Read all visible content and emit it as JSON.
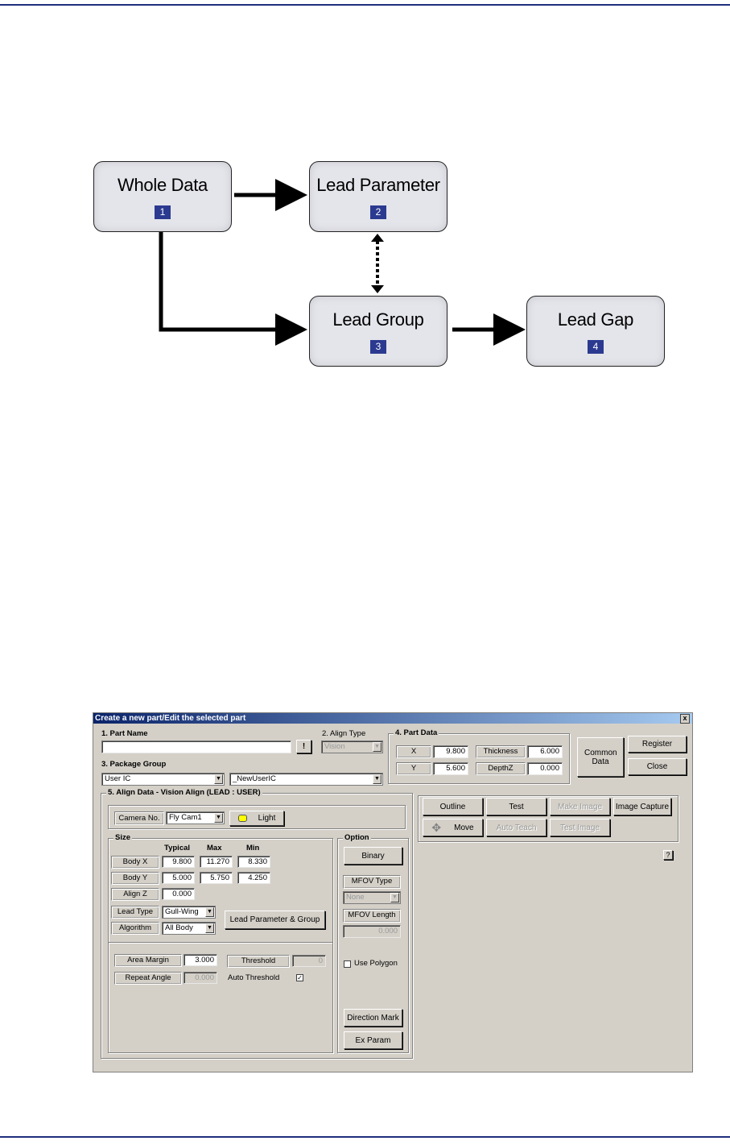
{
  "flowchart": {
    "nodes": [
      {
        "title": "Whole Data",
        "num": "1"
      },
      {
        "title": "Lead Parameter",
        "num": "2"
      },
      {
        "title": "Lead Group",
        "num": "3"
      },
      {
        "title": "Lead Gap",
        "num": "4"
      }
    ],
    "colors": {
      "node_bg": "#e4e5ea",
      "badge": "#2b3a90",
      "rule": "#1e2f7d"
    }
  },
  "dialog": {
    "title": "Create a new part/Edit the selected part",
    "close_glyph": "x",
    "part_name": {
      "label": "1. Part Name",
      "value": "",
      "bang": "!"
    },
    "align_type": {
      "label": "2. Align Type",
      "value": "Vision"
    },
    "package_group": {
      "label": "3. Package Group",
      "value1": "User IC",
      "value2": "_NewUserIC"
    },
    "part_data": {
      "label": "4. Part Data",
      "x_label": "X",
      "x": "9.800",
      "y_label": "Y",
      "y": "5.600",
      "thickness_label": "Thickness",
      "thickness": "6.000",
      "depthz_label": "DepthZ",
      "depthz": "0.000"
    },
    "common_data": "Common Data",
    "register": "Register",
    "close": "Close",
    "align_data": {
      "label": "5. Align Data - Vision Align (LEAD : USER)",
      "camera_label": "Camera No.",
      "camera": "Fly Cam1",
      "light": "Light",
      "size": {
        "label": "Size",
        "typical": "Typical",
        "max": "Max",
        "min": "Min",
        "body_x_label": "Body X",
        "body_x": [
          "9.800",
          "11.270",
          "8.330"
        ],
        "body_y_label": "Body Y",
        "body_y": [
          "5.000",
          "5.750",
          "4.250"
        ],
        "align_z_label": "Align Z",
        "align_z": "0.000",
        "lead_type_label": "Lead Type",
        "lead_type": "Gull-Wing",
        "algorithm_label": "Algorithm",
        "algorithm": "All Body",
        "lead_param_group": "Lead Parameter & Group",
        "area_margin_label": "Area Margin",
        "area_margin": "3.000",
        "repeat_angle_label": "Repeat Angle",
        "repeat_angle": "0.000",
        "threshold_label": "Threshold",
        "threshold": "0",
        "auto_threshold_label": "Auto Threshold",
        "auto_threshold_mark": "✓"
      },
      "option": {
        "label": "Option",
        "binary": "Binary",
        "mfov_type_label": "MFOV Type",
        "mfov_type": "None",
        "mfov_length_label": "MFOV Length",
        "mfov_length": "0.000",
        "use_polygon": "Use Polygon",
        "direction_mark": "Direction Mark",
        "ex_param": "Ex Param"
      }
    },
    "tools": {
      "outline": "Outline",
      "test": "Test",
      "make_image": "Make Image",
      "image_capture": "Image Capture",
      "move": "Move",
      "auto_teach": "Auto Teach",
      "test_image": "Test Image"
    },
    "help": "?"
  }
}
